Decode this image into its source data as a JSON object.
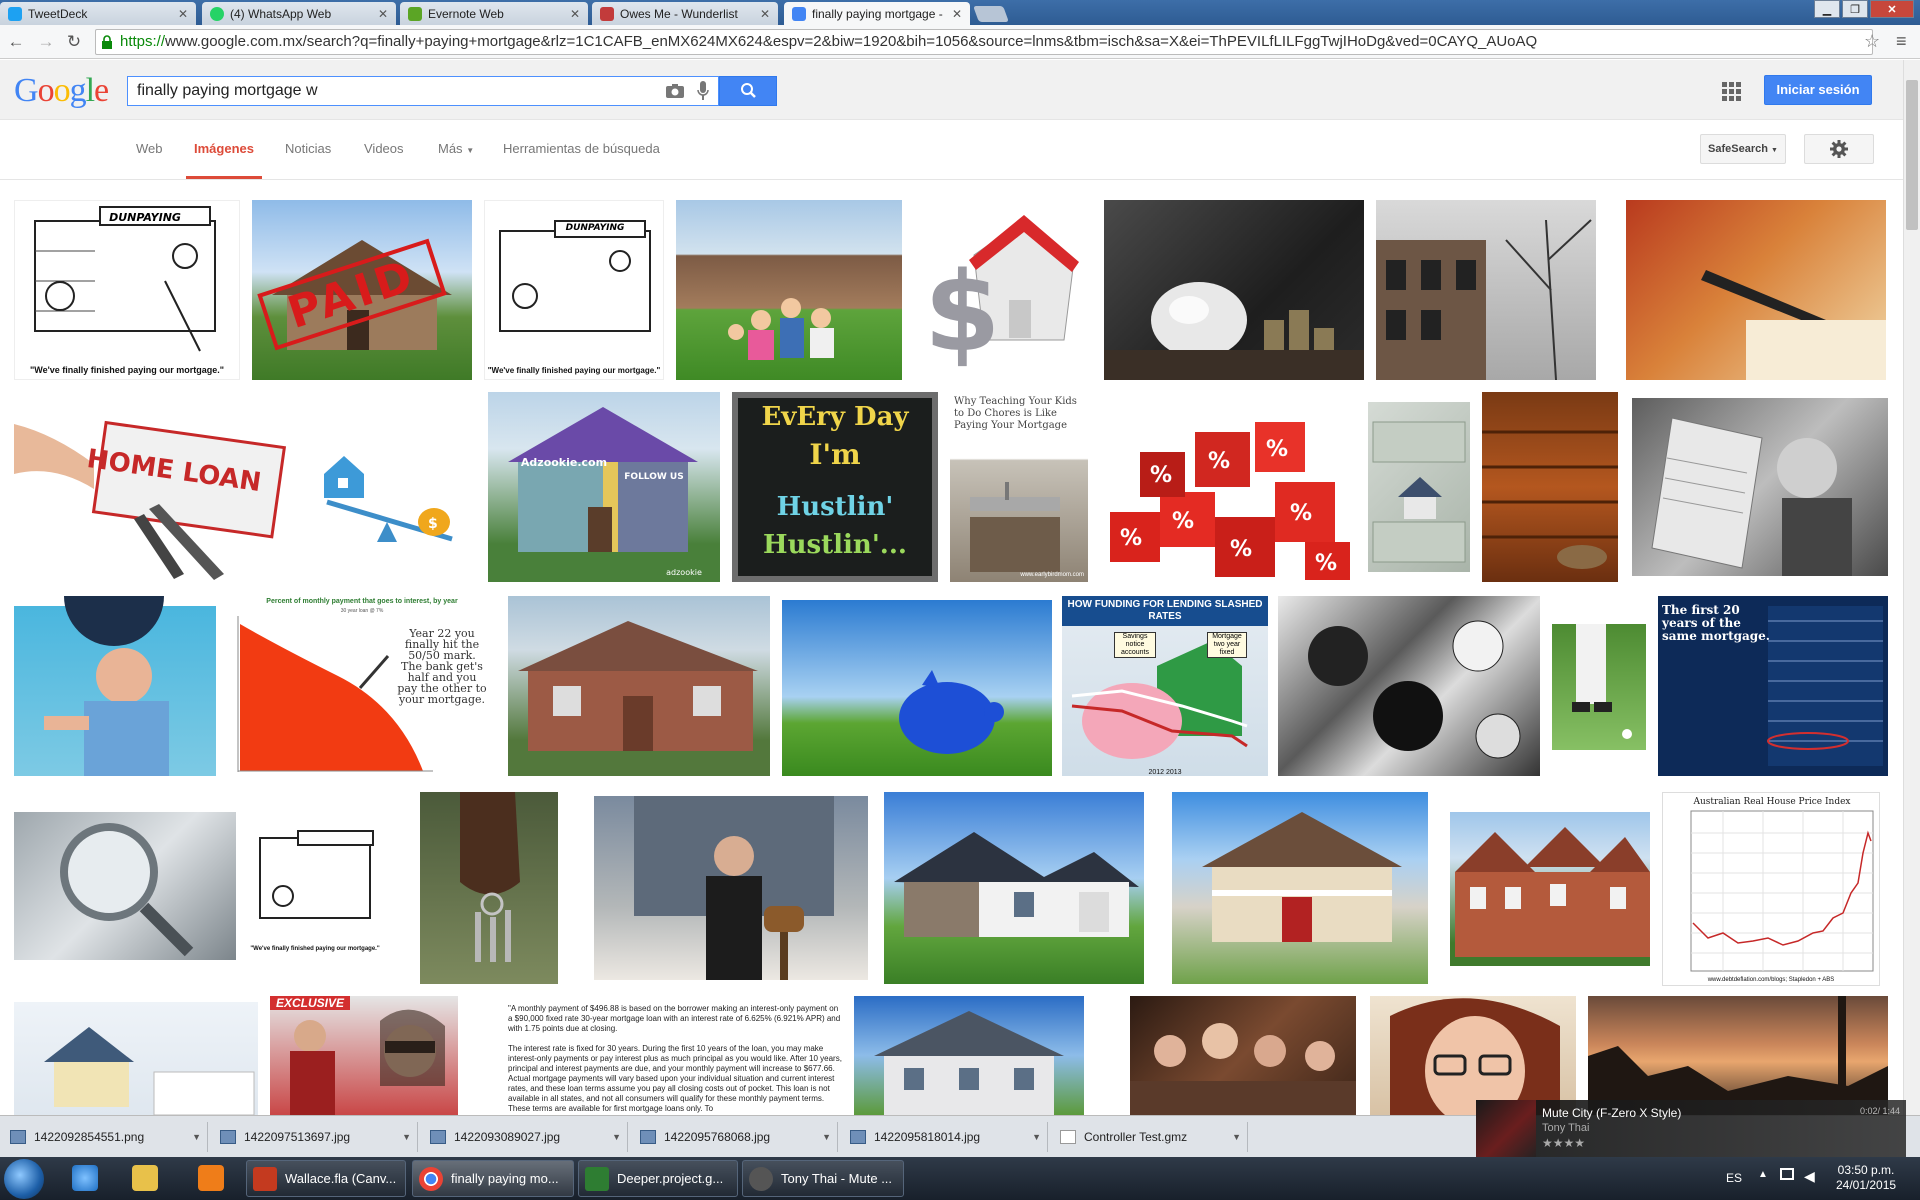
{
  "browser": {
    "tabs": [
      {
        "label": "TweetDeck",
        "color": "#1da1f2"
      },
      {
        "label": "(4) WhatsApp Web",
        "color": "#25d366"
      },
      {
        "label": "Evernote Web",
        "color": "#5ba525"
      },
      {
        "label": "Owes Me - Wunderlist",
        "color": "#c23b3b"
      },
      {
        "label": "finally paying mortgage -",
        "color": "#4285f4"
      }
    ],
    "url_scheme": "https://",
    "url_rest": "www.google.com.mx/search?q=finally+paying+mortgage&rlz=1C1CAFB_enMX624MX624&espv=2&biw=1920&bih=1056&source=lnms&tbm=isch&sa=X&ei=ThPEVILfLILFggTwjIHoDg&ved=0CAYQ_AUoAQ"
  },
  "google": {
    "logo": "Google",
    "search_value": "finally paying mortgage w",
    "signin_label": "Iniciar sesión",
    "nav": {
      "web": "Web",
      "images": "Imágenes",
      "news": "Noticias",
      "videos": "Videos",
      "more": "Más",
      "tools": "Herramientas de búsqueda"
    },
    "safesearch": "SafeSearch"
  },
  "thumb_text": {
    "cartoon_sign": "DUNPAYING",
    "cartoon_caption": "\"We've finally finished paying our mortgage.\"",
    "paid": "PAID",
    "home_loan": "HOME LOAN",
    "adzookie": "Adzookie.com",
    "adzookie_small": "FOLLOW US",
    "adzookie_credit": "adzookie",
    "hustle_1": "EvEry Day",
    "hustle_2": "I'm",
    "hustle_3": "Hustlin'",
    "hustle_4": "Hustlin'...",
    "chores": "Why Teaching Your Kids to Do Chores is Like Paying Your Mortgage",
    "chores_credit": "www.earlybirdmom.com",
    "percent_chart_title": "Percent of monthly payment that goes to interest, by year",
    "percent_chart_sub": "30 year loan @ 7%",
    "percent_chart_note": "Year 22 you finally hit the 50/50 mark. The bank get's half and you pay the other to your mortgage.",
    "funding_title": "HOW FUNDING FOR LENDING SLASHED RATES",
    "funding_savings": "Savings notice accounts",
    "funding_mortgage": "Mortgage two year fixed",
    "funding_years": "2012                2013",
    "blue_title": "The first 20 years of the same mortgage.",
    "aus_title": "Australian Real House Price Index",
    "aus_credit": "www.debtdeflation.com/blogs; Stapledon + ABS",
    "exclusive": "EXCLUSIVE",
    "loan_text": "\"A monthly payment of $496.88 is based on the borrower making an interest-only payment on a $90,000 fixed rate 30-year mortgage loan with an interest rate of 6.625% (6.921% APR) and with 1.75 points due at closing.\n\nThe interest rate is fixed for 30 years. During the first 10 years of the loan, you may make interest-only payments or pay interest plus as much principal as you would like. After 10 years, principal and interest payments are due, and your monthly payment will increase to $677.66. Actual mortgage payments will vary based upon your individual situation and current interest rates, and these loan terms assume you pay all closing costs out of pocket. This loan is not available in all states, and not all consumers will qualify for these monthly payment terms. These terms are available for first mortgage loans only. To"
  },
  "downloads": [
    "1422092854551.png",
    "1422097513697.jpg",
    "1422093089027.jpg",
    "1422095768068.jpg",
    "1422095818014.jpg",
    "Controller Test.gmz"
  ],
  "media": {
    "title": "Mute City (F-Zero X Style)",
    "artist": "Tony Thai",
    "time": "0:02/ 1:44",
    "stars": "★★★★"
  },
  "taskbar": {
    "items": [
      {
        "label": "Wallace.fla (Canv...",
        "color": "#c43a1f"
      },
      {
        "label": "finally paying mo...",
        "color": "#4285f4"
      },
      {
        "label": "Deeper.project.g...",
        "color": "#2e7d32"
      },
      {
        "label": "Tony Thai - Mute ...",
        "color": "#555555"
      }
    ],
    "lang": "ES",
    "time": "03:50 p.m.",
    "date": "24/01/2015"
  },
  "colors": {
    "accent_blue": "#4285f4",
    "active_red": "#dd4b39"
  }
}
